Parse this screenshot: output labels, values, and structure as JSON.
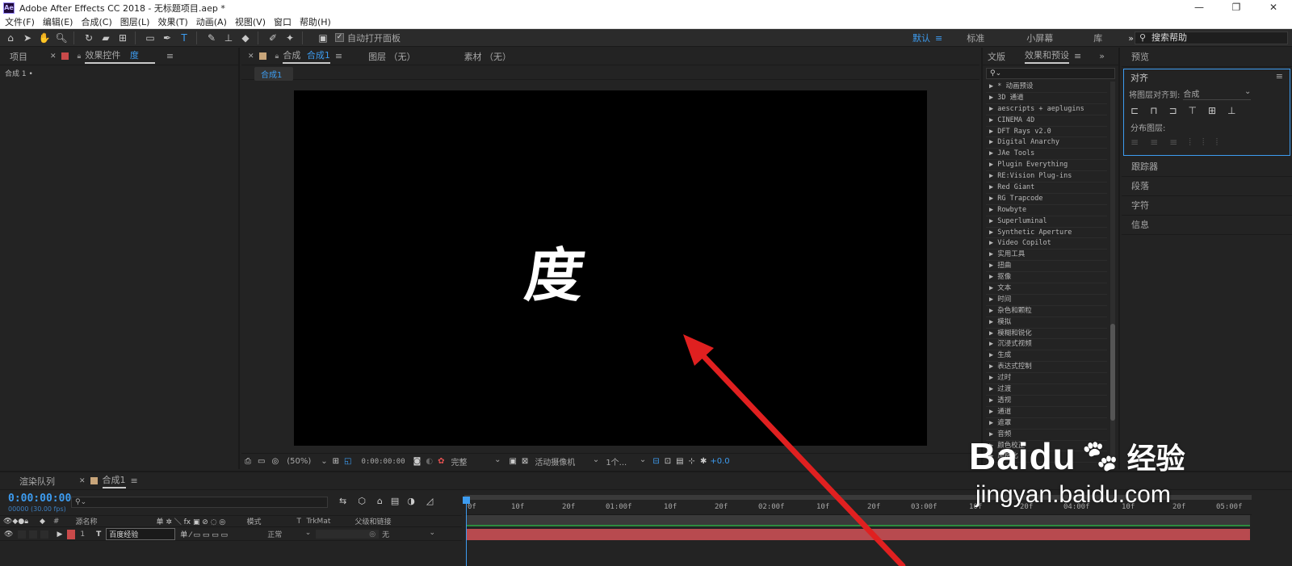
{
  "window": {
    "title": "Adobe After Effects CC 2018 - 无标题项目.aep *",
    "logo": "Ae",
    "controls": [
      "—",
      "❐",
      "✕"
    ]
  },
  "menu": [
    "文件(F)",
    "编辑(E)",
    "合成(C)",
    "图层(L)",
    "效果(T)",
    "动画(A)",
    "视图(V)",
    "窗口",
    "帮助(H)"
  ],
  "toolbar": {
    "auto_open_label": "自动打开面板",
    "workspaces": [
      "默认",
      "标准",
      "小屏幕",
      "库"
    ],
    "workspace_more": "»",
    "help_placeholder": "搜索帮助"
  },
  "project_panel": {
    "tab_project": "项目",
    "tab_effects": "效果控件",
    "tab_effects_layer": "度",
    "breadcrumb": "合成 1 •"
  },
  "comp_panel": {
    "tab_comp_prefix": "合成",
    "tab_comp_name": "合成1",
    "tab_layer": "图层 （无）",
    "tab_footage": "素材 （无）",
    "comp_button": "合成1",
    "canvas_text": "度",
    "zoom": "(50%)",
    "timecode": "0:00:00:00",
    "quality": "完整",
    "camera": "活动摄像机",
    "views": "1个...",
    "exposure": "+0.0"
  },
  "effects_panel": {
    "tab_library": "文版",
    "tab_effects": "效果和预设",
    "search_placeholder": "",
    "items": [
      "▶ * 动画预设",
      "▶ 3D 通道",
      "▶ aescripts + aeplugins",
      "▶ CINEMA 4D",
      "▶ DFT Rays v2.0",
      "▶ Digital Anarchy",
      "▶ JAe Tools",
      "▶ Plugin Everything",
      "▶ RE:Vision Plug-ins",
      "▶ Red Giant",
      "▶ RG Trapcode",
      "▶ Rowbyte",
      "▶ Superluminal",
      "▶ Synthetic Aperture",
      "▶ Video Copilot",
      "▶ 实用工具",
      "▶ 扭曲",
      "▶ 抠像",
      "▶ 文本",
      "▶ 时间",
      "▶ 杂色和颗粒",
      "▶ 模拟",
      "▶ 模糊和锐化",
      "▶ 沉浸式视频",
      "▶ 生成",
      "▶ 表达式控制",
      "▶ 过时",
      "▶ 过渡",
      "▶ 透视",
      "▶ 通道",
      "▶ 遮罩",
      "▶ 音频",
      "▶ 颜色校正",
      "▶ 风格化"
    ]
  },
  "right_panel": {
    "preview": "预览",
    "align_title": "对齐",
    "align_to_label": "将图层对齐到:",
    "align_to_value": "合成",
    "distribute_label": "分布图层:",
    "sections": [
      "跟踪器",
      "段落",
      "字符",
      "信息"
    ]
  },
  "timeline": {
    "tab_render": "渲染队列",
    "tab_comp": "合成1",
    "timecode": "0:00:00:00",
    "fps": "00000 (30.00 fps)",
    "cols": {
      "name": "源名称",
      "switches": "单 ✲ ＼ fx ▣ ⊘ ◌ ◎",
      "mode": "模式",
      "t": "T",
      "trkmat": "TrkMat",
      "parent": "父级和链接"
    },
    "ruler": [
      "0f",
      "10f",
      "20f",
      "01:00f",
      "10f",
      "20f",
      "02:00f",
      "10f",
      "20f",
      "03:00f",
      "10f",
      "20f",
      "04:00f",
      "10f",
      "20f",
      "05:00f"
    ],
    "layer": {
      "num": "1",
      "type": "T",
      "name": "百度经验",
      "mode": "正常",
      "parent": "无"
    }
  },
  "watermark": {
    "brand": "Baidu",
    "brand_cn": "经验",
    "url": "jingyan.baidu.com"
  },
  "colors": {
    "accent_blue": "#3d9cf0",
    "label_red": "#c94a4a",
    "layer_bar": "#b84a4f",
    "arrow_red": "#e02020"
  }
}
